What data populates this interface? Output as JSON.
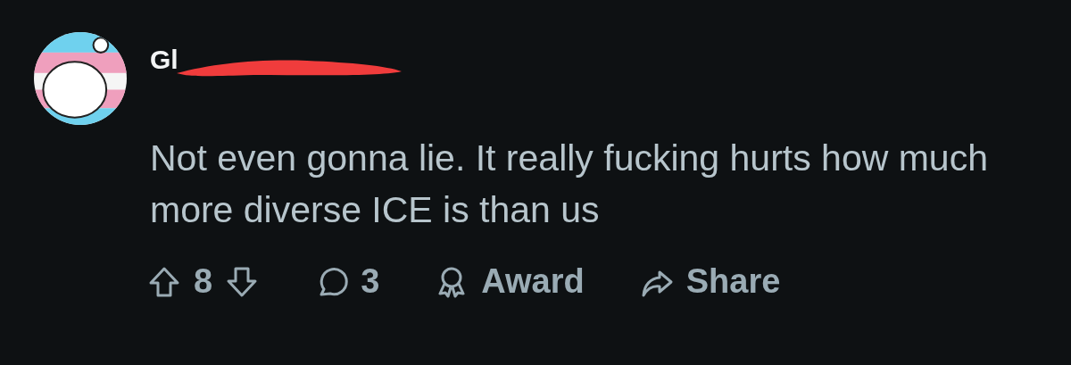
{
  "comment": {
    "username": "Gl",
    "username_redacted": true,
    "body": "Not even gonna lie. It really fucking hurts how much more diverse ICE is than us"
  },
  "actions": [
    {
      "kind": "votes",
      "label": "8"
    },
    {
      "kind": "comments",
      "label": "3"
    },
    {
      "kind": "award",
      "label": "Award"
    },
    {
      "kind": "share",
      "label": "Share"
    }
  ]
}
